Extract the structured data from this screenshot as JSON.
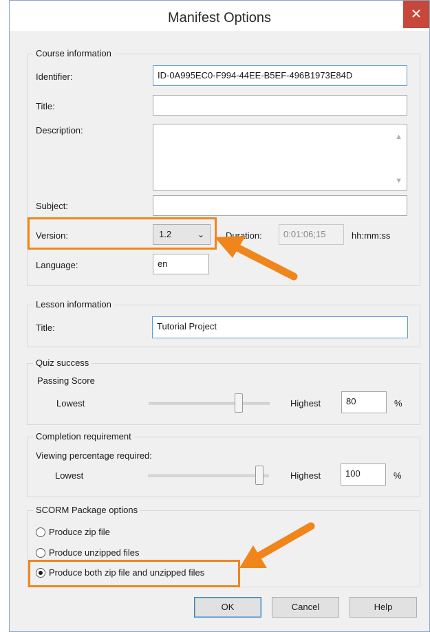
{
  "window": {
    "title": "Manifest Options",
    "close_symbol": "✕"
  },
  "course_info": {
    "legend": "Course information",
    "identifier_label": "Identifier:",
    "identifier_value": "ID-0A995EC0-F994-44EE-B5EF-496B1973E84D",
    "title_label": "Title:",
    "title_value": "",
    "description_label": "Description:",
    "description_value": "",
    "subject_label": "Subject:",
    "subject_value": "",
    "version_label": "Version:",
    "version_value": "1.2",
    "duration_label": "Duration:",
    "duration_value": "0:01:06;15",
    "duration_unit": "hh:mm:ss",
    "language_label": "Language:",
    "language_value": "en"
  },
  "lesson_info": {
    "legend": "Lesson information",
    "title_label": "Title:",
    "title_value": "Tutorial Project"
  },
  "quiz_success": {
    "legend": "Quiz success",
    "sub_label": "Passing Score",
    "lowest_label": "Lowest",
    "highest_label": "Highest",
    "value": "80",
    "unit": "%",
    "level_percent": 80
  },
  "completion": {
    "legend": "Completion requirement",
    "sub_label": "Viewing percentage required:",
    "lowest_label": "Lowest",
    "highest_label": "Highest",
    "value": "100",
    "unit": "%",
    "level_percent": 100
  },
  "scorm": {
    "legend": "SCORM Package options",
    "options": [
      {
        "label": "Produce zip file",
        "checked": false
      },
      {
        "label": "Produce unzipped files",
        "checked": false
      },
      {
        "label": "Produce both zip file and unzipped files",
        "checked": true
      }
    ]
  },
  "buttons": {
    "ok": "OK",
    "cancel": "Cancel",
    "help": "Help"
  },
  "colors": {
    "annotation": "#f0851c",
    "close": "#c7473a",
    "focus": "#5a9bd5"
  }
}
